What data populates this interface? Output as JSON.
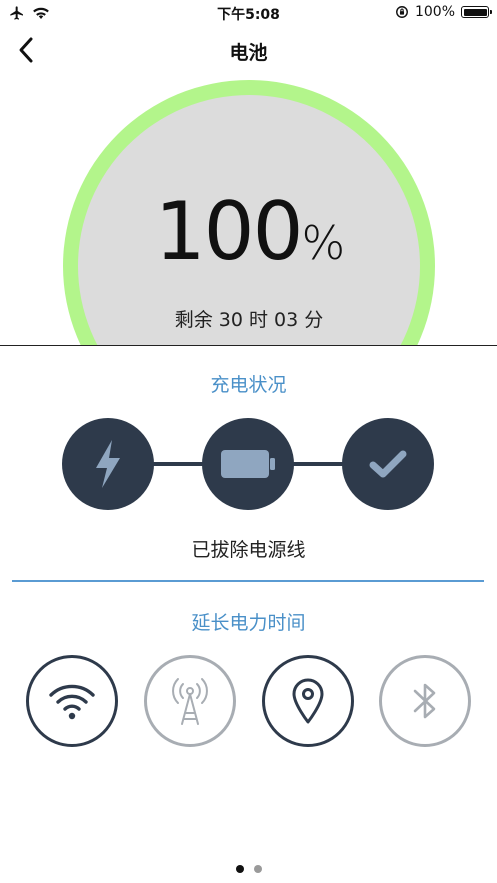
{
  "status_bar": {
    "time": "下午5:08",
    "battery_text": "100%",
    "battery_level": 1.0
  },
  "nav": {
    "title": "电池"
  },
  "gauge": {
    "percent_value": "100",
    "percent_unit": "%",
    "remaining": "剩余 30 时 03 分",
    "ring_color": "#b3f58b"
  },
  "charging": {
    "title": "充电状况",
    "steps": [
      {
        "icon": "lightning-bolt-icon"
      },
      {
        "icon": "battery-icon"
      },
      {
        "icon": "checkmark-icon"
      }
    ],
    "status": "已拔除电源线"
  },
  "extend": {
    "title": "延长电力时间",
    "toggles": [
      {
        "icon": "wifi-icon",
        "state": "on"
      },
      {
        "icon": "cellular-tower-icon",
        "state": "off"
      },
      {
        "icon": "location-pin-icon",
        "state": "on"
      },
      {
        "icon": "bluetooth-icon",
        "state": "off"
      }
    ]
  },
  "pager": {
    "current": 1,
    "total": 2
  },
  "colors": {
    "accent_blue": "#4a90c8",
    "dark_circle": "#2e3a4b",
    "disabled_gray": "#a8adb3",
    "gauge_inner": "#dcdcdc"
  }
}
